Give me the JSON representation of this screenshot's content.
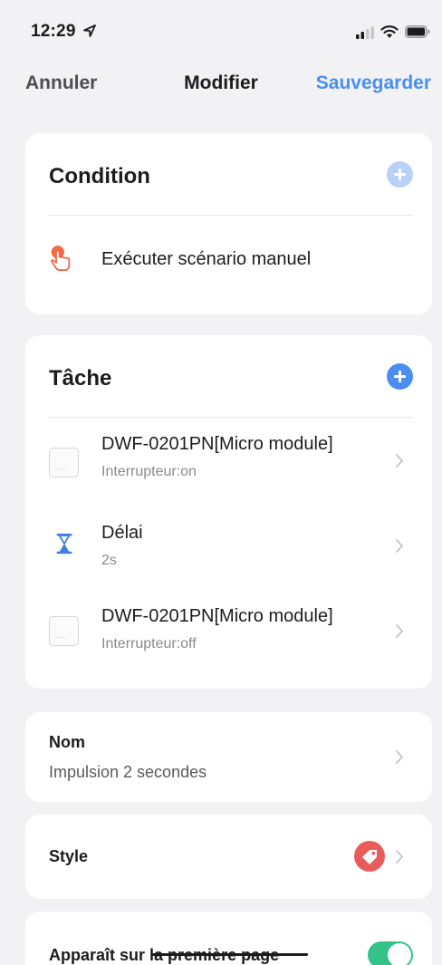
{
  "status_bar": {
    "time": "12:29",
    "icons": [
      "location-arrow-icon",
      "cellular-signal-icon",
      "wifi-icon",
      "battery-icon"
    ]
  },
  "nav": {
    "cancel_label": "Annuler",
    "title": "Modifier",
    "save_label": "Sauvegarder"
  },
  "condition": {
    "header": "Condition",
    "item": {
      "label": "Exécuter scénario manuel",
      "icon": "hand-tap-icon"
    }
  },
  "task": {
    "header": "Tâche",
    "items": [
      {
        "title": "DWF-0201PN[Micro module]",
        "subtitle": "Interrupteur:on",
        "icon": "module-icon"
      },
      {
        "title": "Délai",
        "subtitle": "2s",
        "icon": "hourglass-icon"
      },
      {
        "title": "DWF-0201PN[Micro module]",
        "subtitle": "Interrupteur:off",
        "icon": "module-icon"
      }
    ]
  },
  "name_section": {
    "label": "Nom",
    "value": "Impulsion 2 secondes"
  },
  "style_section": {
    "label": "Style",
    "icon": "tag-icon"
  },
  "first_page_section": {
    "label": "Apparaît sur la première page",
    "enabled": true
  },
  "colors": {
    "accent_blue": "#4a8ff0",
    "add_disabled": "#b9d1f7",
    "hand_orange": "#f06a46",
    "hourglass_blue": "#3f7fe0",
    "tag_red": "#e85c5c",
    "toggle_green": "#34c28a",
    "background": "#f2f2f4"
  }
}
